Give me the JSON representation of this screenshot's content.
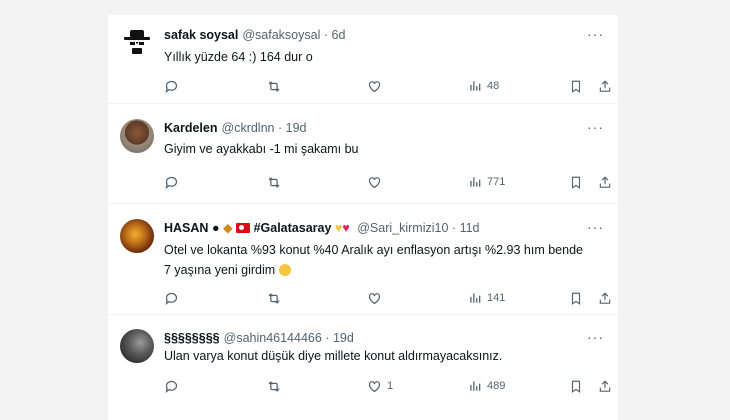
{
  "tweets": [
    {
      "name": "safak soysal",
      "handle": "@safaksoysal",
      "sep": "·",
      "time": "6d",
      "text": "Yıllık yüzde 64  :) 164 dur o",
      "reply_count": "",
      "retweet_count": "",
      "like_count": "",
      "views": "48",
      "avatar": "heisenberg-avatar"
    },
    {
      "name": "Kardelen",
      "handle": "@ckrdlnn",
      "sep": "·",
      "time": "19d",
      "text": "Giyim ve ayakkabı -1 mi şakamı bu",
      "reply_count": "",
      "retweet_count": "",
      "like_count": "",
      "views": "771",
      "avatar": "photo-avatar"
    },
    {
      "name": "HASAN",
      "name_suffix": "#Galatasaray",
      "handle": "@Sari_kirmizi10",
      "sep": "·",
      "time": "11d",
      "text_line1": "Otel ve lokanta %93 konut %40 Aralık ayı enflasyon artışı %2.93 hım bende",
      "text_line2": "7 yaşına yeni girdim",
      "reply_count": "",
      "retweet_count": "",
      "like_count": "",
      "views": "141",
      "avatar": "lion-avatar"
    },
    {
      "name": "§§§§§§§§",
      "handle": "@sahin46144466",
      "sep": "·",
      "time": "19d",
      "text": "Ulan varya konut düşük diye millete konut aldırmayacaksınız.",
      "reply_count": "",
      "retweet_count": "",
      "like_count": "1",
      "views": "489",
      "avatar": "dark-photo-avatar"
    }
  ],
  "more_glyph": "···",
  "colors": {
    "text": "#0f1419",
    "muted": "#536471",
    "divider": "#eff3f4"
  }
}
